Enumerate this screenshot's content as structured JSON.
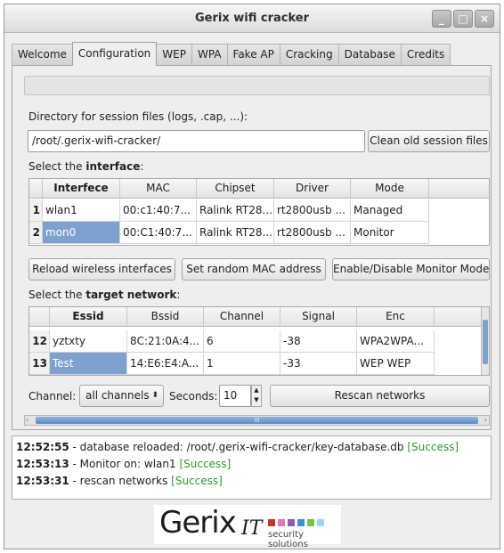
{
  "window": {
    "title": "Gerix wifi cracker",
    "controls": [
      "_",
      "□",
      "×"
    ]
  },
  "tabs": [
    "Welcome",
    "Configuration",
    "WEP",
    "WPA",
    "Fake AP",
    "Cracking",
    "Database",
    "Credits"
  ],
  "active_tab": "Configuration",
  "config": {
    "dir_label": "Directory for session files (logs, .cap, ...):",
    "dir_value": "/root/.gerix-wifi-cracker/",
    "clean_button": "Clean old session files",
    "interface_label_pre": "Select the ",
    "interface_label_bold": "interface",
    "interface_label_post": ":",
    "interface_table": {
      "headers": [
        "",
        "Interfece",
        "MAC",
        "Chipset",
        "Driver",
        "Mode"
      ],
      "rows": [
        {
          "num": "1",
          "iface": "wlan1",
          "mac": "00:c1:40:7...",
          "chipset": "Ralink RT28...",
          "driver": "rt2800usb ...",
          "mode": "Managed"
        },
        {
          "num": "2",
          "iface": "mon0",
          "mac": "00:C1:40:7...",
          "chipset": "Ralink RT28...",
          "driver": "rt2800usb ...",
          "mode": "Monitor"
        }
      ]
    },
    "reload_button": "Reload wireless interfaces",
    "random_mac_button": "Set random MAC address",
    "monitor_button": "Enable/Disable Monitor Mode",
    "network_label_pre": "Select the ",
    "network_label_bold": "target network",
    "network_label_post": ":",
    "network_table": {
      "headers": [
        "",
        "Essid",
        "Bssid",
        "Channel",
        "Signal",
        "Enc"
      ],
      "rows": [
        {
          "num": "12",
          "essid": "yztxty",
          "bssid": "8C:21:0A:4...",
          "channel": "6",
          "signal": "-38",
          "enc": "WPA2WPA..."
        },
        {
          "num": "13",
          "essid": "Test",
          "bssid": "14:E6:E4:A...",
          "channel": "1",
          "signal": "-33",
          "enc": "WEP WEP"
        }
      ]
    },
    "channel_label": "Channel:",
    "channel_value": "all channels",
    "seconds_label": "Seconds:",
    "seconds_value": "10",
    "rescan_button": "Rescan networks",
    "hscroll_grip": "III"
  },
  "log": [
    {
      "time": "12:52:55",
      "text": " - database reloaded: /root/.gerix-wifi-cracker/key-database.db ",
      "status": "[Success]"
    },
    {
      "time": "12:53:13",
      "text": " - Monitor on: wlan1 ",
      "status": "[Success]"
    },
    {
      "time": "12:53:31",
      "text": " - rescan networks ",
      "status": "[Success]"
    }
  ],
  "logo": {
    "main": "Gerix",
    "it": "IT",
    "sub": "security solutions",
    "square_colors": [
      "#c0392b",
      "#e07bb5",
      "#8e5fb0",
      "#3e8fd0",
      "#7bc043",
      "#9fd4f0"
    ]
  }
}
